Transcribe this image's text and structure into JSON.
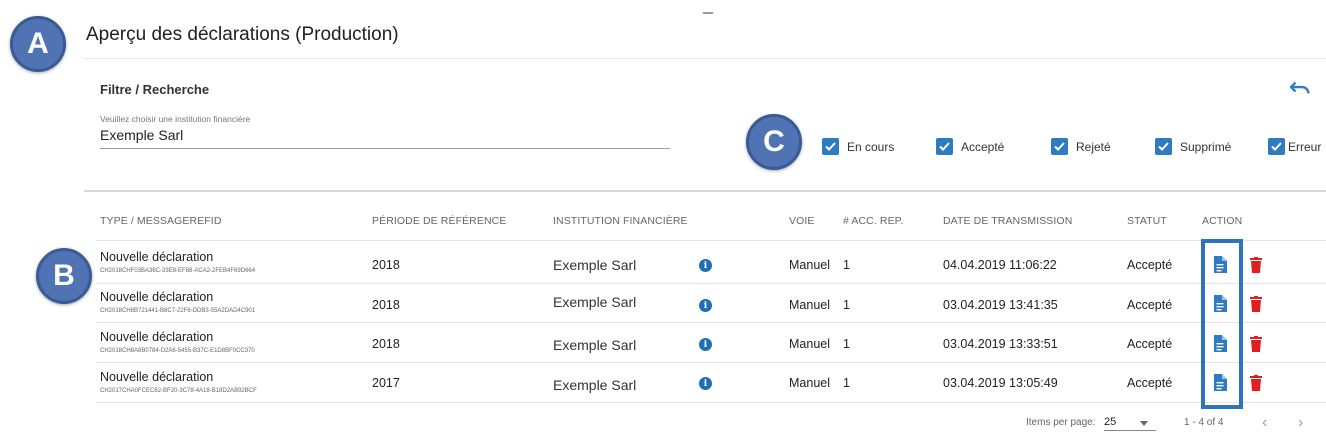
{
  "badges": {
    "a": "A",
    "b": "B",
    "c": "C"
  },
  "page": {
    "title": "Aperçu des déclarations (Production)"
  },
  "filter": {
    "title": "Filtre / Recherche",
    "institution_label": "Veuillez choisir une institution financière",
    "institution_value": "Exemple Sarl",
    "undo_icon": "undo-icon",
    "status_filters": [
      {
        "label": "En cours",
        "checked": true
      },
      {
        "label": "Accepté",
        "checked": true
      },
      {
        "label": "Rejeté",
        "checked": true
      },
      {
        "label": "Supprimé",
        "checked": true
      },
      {
        "label": "Erreur",
        "checked": true
      }
    ]
  },
  "table": {
    "headers": {
      "type": "TYPE / MESSAGEREFID",
      "period": "PÉRIODE DE RÉFÉRENCE",
      "institution": "INSTITUTION FINANCIÈRE",
      "channel": "VOIE",
      "acc": "# ACC. REP.",
      "date": "DATE DE TRANSMISSION",
      "status": "STATUT",
      "action": "ACTION"
    },
    "rows": [
      {
        "type": "Nouvelle déclaration",
        "msgid": "CH2018CHF03BA36C-33E9-EF88-ACA2-2FEB4F69D664",
        "period": "2018",
        "institution": "Exemple Sarl",
        "channel": "Manuel",
        "acc": "1",
        "date": "04.04.2019 11:06:22",
        "status": "Accepté"
      },
      {
        "type": "Nouvelle déclaration",
        "msgid": "CH2018CH8B721441-B8C7-22F6-DDB3-55A2DAD4C901",
        "period": "2018",
        "institution": "Exemple Sarl",
        "channel": "Manuel",
        "acc": "1",
        "date": "03.04.2019 13:41:35",
        "status": "Accepté"
      },
      {
        "type": "Nouvelle déclaration",
        "msgid": "CH2018CH8A8B0784-D2A6-5455-B37C-E1D8BF0CC370",
        "period": "2018",
        "institution": "Exemple Sarl",
        "channel": "Manuel",
        "acc": "1",
        "date": "03.04.2019 13:33:51",
        "status": "Accepté"
      },
      {
        "type": "Nouvelle déclaration",
        "msgid": "CH2017CHA0FCEC62-BF20-3C78-4A18-B18D2AB92BCF",
        "period": "2017",
        "institution": "Exemple Sarl",
        "channel": "Manuel",
        "acc": "1",
        "date": "03.04.2019 13:05:49",
        "status": "Accepté"
      }
    ]
  },
  "paginator": {
    "label": "Items per page:",
    "page_size": "25",
    "range": "1 - 4 of 4",
    "prev": "‹",
    "next": "›"
  },
  "colors": {
    "accent": "#2e7bc1",
    "badge": "#4f73b3",
    "delete": "#e02020",
    "info": "#1f6eb8"
  }
}
